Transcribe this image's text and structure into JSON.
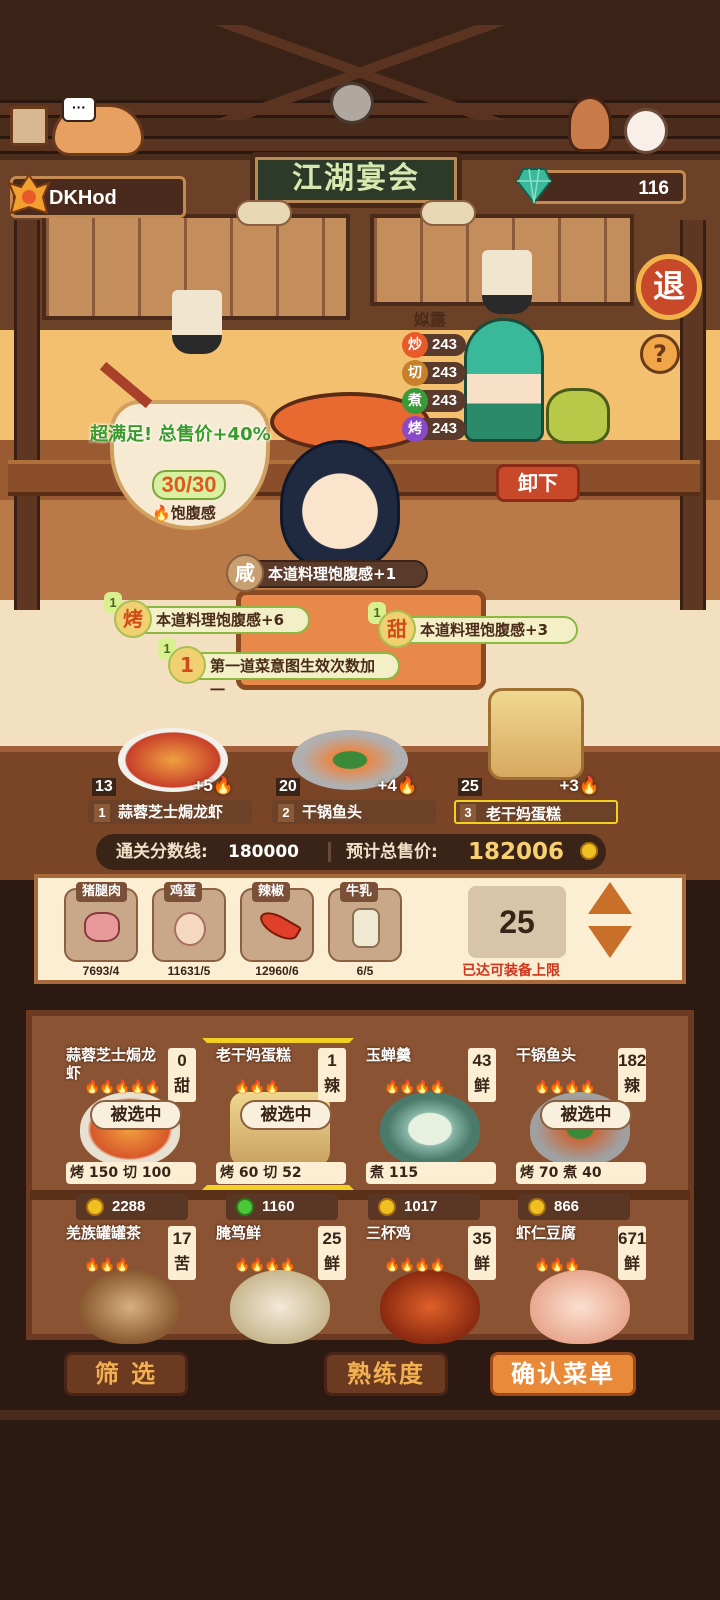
{
  "header": {
    "player_name": "DKHod",
    "gems": "116",
    "title": "江湖宴会",
    "exit_label": "退",
    "help_label": "?"
  },
  "chef": {
    "name": "姒露",
    "stats": [
      {
        "icon": "炒",
        "value": "243",
        "color": "#e85a2a"
      },
      {
        "icon": "切",
        "value": "243",
        "color": "#c8802a"
      },
      {
        "icon": "煮",
        "value": "243",
        "color": "#3a9a3a"
      },
      {
        "icon": "烤",
        "value": "243",
        "color": "#8a4ac8"
      }
    ],
    "unload_label": "卸下"
  },
  "satisfaction": {
    "text": "超满足! 总售价+40%",
    "count": "30/30",
    "label": "饱腹感"
  },
  "buffs": [
    {
      "num": "",
      "icon": "咸",
      "text": "本道料理饱腹感+1"
    },
    {
      "num": "1",
      "icon": "烤",
      "text": "本道料理饱腹感+6"
    },
    {
      "num": "1",
      "icon": "甜",
      "text": "本道料理饱腹感+3"
    },
    {
      "num": "1",
      "icon": "1",
      "text": "第一道菜意图生效次数加一"
    }
  ],
  "table_dishes": [
    {
      "count": "13",
      "plus": "+5",
      "index": "1",
      "name": "蒜蓉芝士焗龙虾"
    },
    {
      "count": "20",
      "plus": "+4",
      "index": "2",
      "name": "干锅鱼头"
    },
    {
      "count": "25",
      "plus": "+3",
      "index": "3",
      "name": "老干妈蛋糕"
    }
  ],
  "score": {
    "threshold_label": "通关分数线:",
    "threshold_value": "180000",
    "estimate_label": "预计总售价:",
    "estimate_value": "182006"
  },
  "ingredients": [
    {
      "name": "猪腿肉",
      "qty": "7693/4",
      "color": "#e89a9a"
    },
    {
      "name": "鸡蛋",
      "qty": "11631/5",
      "color": "#f4d8c0"
    },
    {
      "name": "辣椒",
      "qty": "12960/6",
      "color": "#e0402a"
    },
    {
      "name": "牛乳",
      "qty": "6/5",
      "color": "#f0e8d0"
    }
  ],
  "capacity": {
    "value": "25",
    "label": "已达可装备上限"
  },
  "menu": [
    {
      "name": "蒜蓉芝士焗龙虾",
      "tag_num": "0",
      "tag": "甜",
      "fire": "🔥🔥🔥🔥🔥",
      "selected": "被选中",
      "stats": "烤 150  切 100",
      "price": "2288",
      "color": "#d8582a"
    },
    {
      "name": "老干妈蛋糕",
      "tag_num": "1",
      "tag": "辣",
      "fire": "🔥🔥🔥",
      "selected": "被选中",
      "stats": "烤 60   切 52",
      "price": "1160",
      "color": "#e8d0a0"
    },
    {
      "name": "玉蝉羹",
      "tag_num": "43",
      "tag": "鲜",
      "fire": "🔥🔥🔥🔥",
      "selected": "",
      "stats": "煮 115",
      "price": "1017",
      "color": "#8ab8a8"
    },
    {
      "name": "干锅鱼头",
      "tag_num": "182",
      "tag": "辣",
      "fire": "🔥🔥🔥🔥",
      "selected": "被选中",
      "stats": "烤 70   煮 40",
      "price": "866",
      "color": "#c8683a"
    },
    {
      "name": "羌族罐罐茶",
      "tag_num": "17",
      "tag": "苦",
      "fire": "🔥🔥🔥",
      "selected": "",
      "stats": "",
      "price": "",
      "color": "#b88a5a"
    },
    {
      "name": "腌笃鲜",
      "tag_num": "25",
      "tag": "鲜",
      "fire": "🔥🔥🔥🔥",
      "selected": "",
      "stats": "",
      "price": "",
      "color": "#e8d8b8"
    },
    {
      "name": "三杯鸡",
      "tag_num": "35",
      "tag": "鲜",
      "fire": "🔥🔥🔥🔥",
      "selected": "",
      "stats": "",
      "price": "",
      "color": "#c0401a"
    },
    {
      "name": "虾仁豆腐",
      "tag_num": "671",
      "tag": "鲜",
      "fire": "🔥🔥🔥",
      "selected": "",
      "stats": "",
      "price": "",
      "color": "#f4c8b8"
    }
  ],
  "buttons": {
    "filter": "筛 选",
    "proficiency": "熟练度",
    "confirm": "确认菜单"
  }
}
